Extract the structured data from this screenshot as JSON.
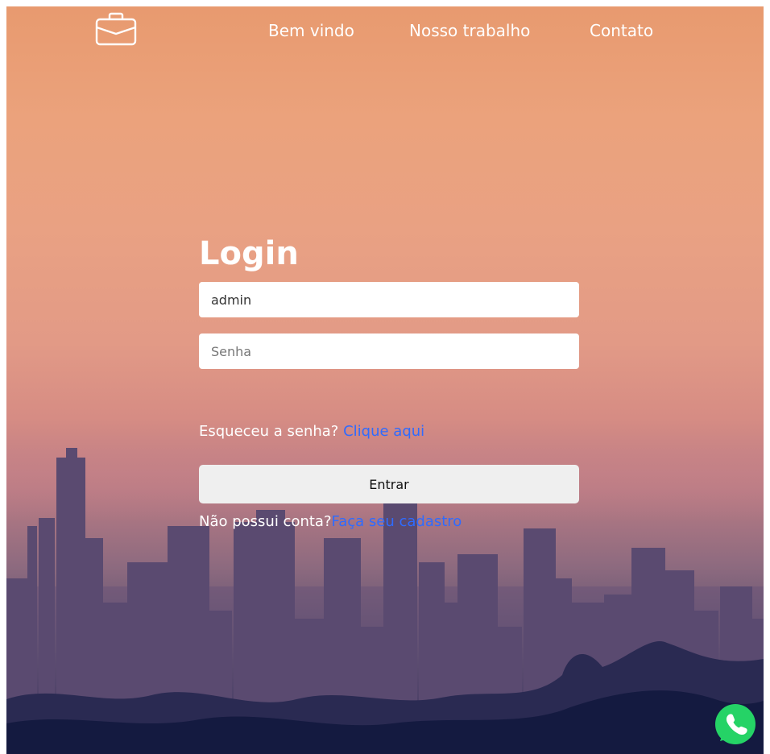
{
  "header": {
    "logo_icon": "briefcase-icon",
    "nav": [
      {
        "label": "Bem vindo"
      },
      {
        "label": "Nosso trabalho"
      },
      {
        "label": "Contato"
      }
    ]
  },
  "login": {
    "title": "Login",
    "username": {
      "value": "admin",
      "placeholder": ""
    },
    "password": {
      "value": "",
      "placeholder": "Senha"
    },
    "forgot_text": "Esqueceu a senha?",
    "forgot_link": "Clique aqui",
    "submit_label": "Entrar",
    "signup_text": "Não possui conta?",
    "signup_link": "Faça seu cadastro"
  },
  "floating": {
    "whatsapp_icon": "whatsapp-icon"
  },
  "colors": {
    "link": "#2f6bff",
    "button_bg": "#efefef",
    "whatsapp": "#25d366"
  }
}
